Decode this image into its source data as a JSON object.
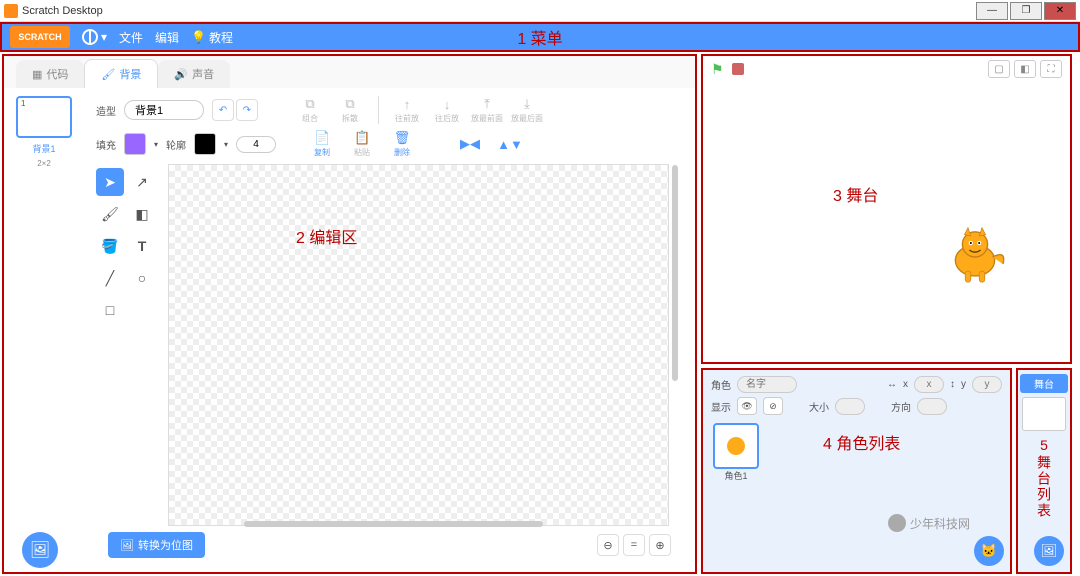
{
  "title": "Scratch Desktop",
  "annotations": {
    "menu": "1 菜单",
    "editor": "2 编辑区",
    "stage": "3 舞台",
    "sprites": "4 角色列表",
    "stagelist_num": "5",
    "stagelist_text": "舞台列表"
  },
  "menu": {
    "logo": "SCRATCH",
    "file": "文件",
    "edit": "编辑",
    "tutorial": "教程"
  },
  "tabs": {
    "code": "代码",
    "backdrops": "背景",
    "sounds": "声音"
  },
  "thumb": {
    "num": "1",
    "label": "背景1",
    "dim": "2×2"
  },
  "editor": {
    "costume_label": "造型",
    "costume_name": "背景1",
    "fill_label": "填充",
    "stroke_label": "轮廓",
    "stroke_width": "4",
    "group": "组合",
    "ungroup": "拆散",
    "front": "往前放",
    "back": "往后放",
    "frontmost": "放最前面",
    "backmost": "放最后面",
    "copy": "复制",
    "paste": "粘贴",
    "delete": "删除",
    "flip_h": "⇄",
    "flip_v": "⇵",
    "convert": "转换为位图"
  },
  "sprite_panel": {
    "sprite_label": "角色",
    "name_placeholder": "名字",
    "x_label": "x",
    "x_placeholder": "x",
    "y_label": "y",
    "y_placeholder": "y",
    "show_label": "显示",
    "size_label": "大小",
    "direction_label": "方向",
    "sprite_name": "角色1"
  },
  "stage_list": {
    "header": "舞台"
  },
  "watermark": "少年科技网"
}
